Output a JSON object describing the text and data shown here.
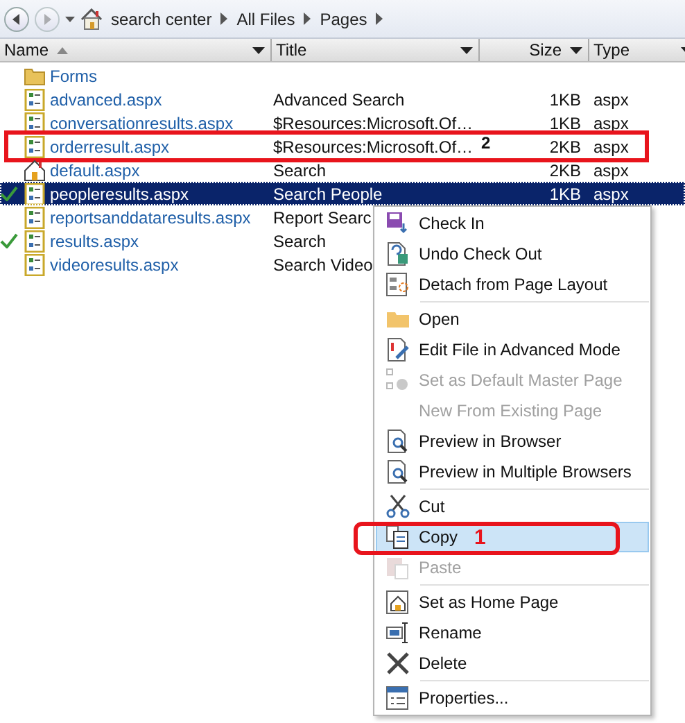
{
  "breadcrumb": {
    "crumbs": [
      "search center",
      "All Files",
      "Pages"
    ]
  },
  "columns": [
    {
      "label": "Name",
      "sorted": true
    },
    {
      "label": "Title",
      "sorted": false
    },
    {
      "label": "Size",
      "sorted": false
    },
    {
      "label": "Type",
      "sorted": false
    }
  ],
  "rows": [
    {
      "kind": "folder",
      "name": "Forms",
      "checked_out": false,
      "selected": false
    },
    {
      "kind": "page",
      "name": "advanced.aspx",
      "title": "Advanced Search",
      "size": "1KB",
      "type": "aspx",
      "checked_out": false,
      "selected": false
    },
    {
      "kind": "page",
      "name": "conversationresults.aspx",
      "title": "$Resources:Microsoft.Of…",
      "size": "1KB",
      "type": "aspx",
      "checked_out": false,
      "selected": false
    },
    {
      "kind": "page",
      "name": "orderresult.aspx",
      "title": "$Resources:Microsoft.Of…",
      "size": "2KB",
      "type": "aspx",
      "checked_out": false,
      "selected": false,
      "annotation": "2"
    },
    {
      "kind": "home",
      "name": "default.aspx",
      "title": "Search",
      "size": "2KB",
      "type": "aspx",
      "checked_out": false,
      "selected": false
    },
    {
      "kind": "page",
      "name": "peopleresults.aspx",
      "title": "Search People",
      "size": "1KB",
      "type": "aspx",
      "checked_out": true,
      "selected": true
    },
    {
      "kind": "page",
      "name": "reportsanddataresults.aspx",
      "title": "Report Searc",
      "checked_out": false,
      "selected": false
    },
    {
      "kind": "page",
      "name": "results.aspx",
      "title": "Search",
      "checked_out": true,
      "selected": false
    },
    {
      "kind": "page",
      "name": "videoresults.aspx",
      "title": "Search Video",
      "checked_out": false,
      "selected": false
    }
  ],
  "menu": {
    "groups": [
      [
        {
          "label": "Check In",
          "disabled": false,
          "selected": false
        },
        {
          "label": "Undo Check Out",
          "disabled": false,
          "selected": false
        },
        {
          "label": "Detach from Page Layout",
          "disabled": false,
          "selected": false
        }
      ],
      [
        {
          "label": "Open",
          "disabled": false,
          "selected": false
        },
        {
          "label": "Edit File in Advanced Mode",
          "disabled": false,
          "selected": false
        },
        {
          "label": "Set as Default Master Page",
          "disabled": true,
          "selected": false
        },
        {
          "label": "New From Existing Page",
          "disabled": true,
          "selected": false
        },
        {
          "label": "Preview in Browser",
          "disabled": false,
          "selected": false
        },
        {
          "label": "Preview in Multiple Browsers",
          "disabled": false,
          "selected": false
        }
      ],
      [
        {
          "label": "Cut",
          "disabled": false,
          "selected": false
        },
        {
          "label": "Copy",
          "disabled": false,
          "selected": true,
          "annotation": "1"
        },
        {
          "label": "Paste",
          "disabled": true,
          "selected": false
        }
      ],
      [
        {
          "label": "Set as Home Page",
          "disabled": false,
          "selected": false
        },
        {
          "label": "Rename",
          "disabled": false,
          "selected": false
        },
        {
          "label": "Delete",
          "disabled": false,
          "selected": false
        }
      ],
      [
        {
          "label": "Properties...",
          "disabled": false,
          "selected": false
        }
      ]
    ]
  }
}
